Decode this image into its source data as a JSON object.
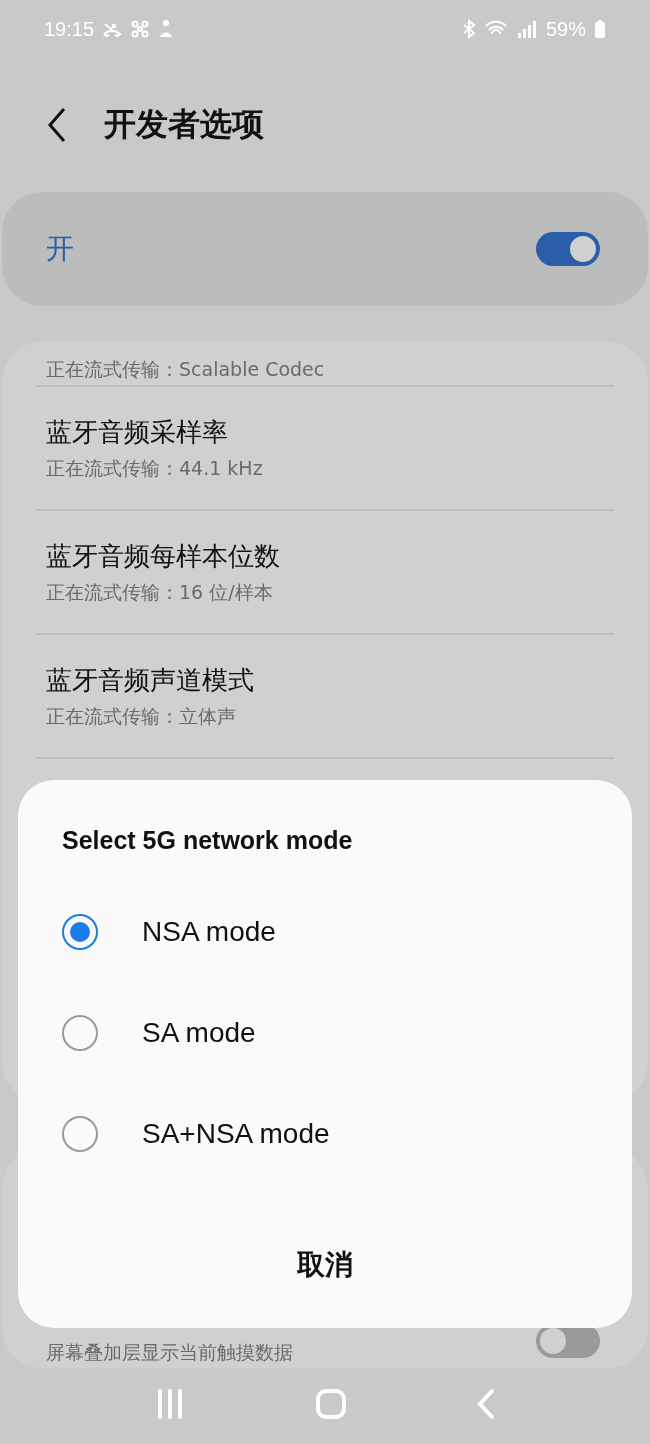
{
  "status_bar": {
    "time": "19:15",
    "battery": "59%"
  },
  "header": {
    "title": "开发者选项"
  },
  "master_switch": {
    "label": "开",
    "on": true
  },
  "settings_list": [
    {
      "subtitle": "正在流式传输：Scalable Codec"
    },
    {
      "title": "蓝牙音频采样率",
      "subtitle": "正在流式传输：44.1 kHz"
    },
    {
      "title": "蓝牙音频每样本位数",
      "subtitle": "正在流式传输：16 位/样本"
    },
    {
      "title": "蓝牙音频声道模式",
      "subtitle": "正在流式传输：立体声"
    }
  ],
  "touch_setting": {
    "subtitle": "屏幕叠加层显示当前触摸数据",
    "on": false
  },
  "dialog": {
    "title": "Select 5G network mode",
    "options": [
      {
        "label": "NSA mode",
        "selected": true
      },
      {
        "label": "SA mode",
        "selected": false
      },
      {
        "label": "SA+NSA mode",
        "selected": false
      }
    ],
    "cancel": "取消"
  }
}
